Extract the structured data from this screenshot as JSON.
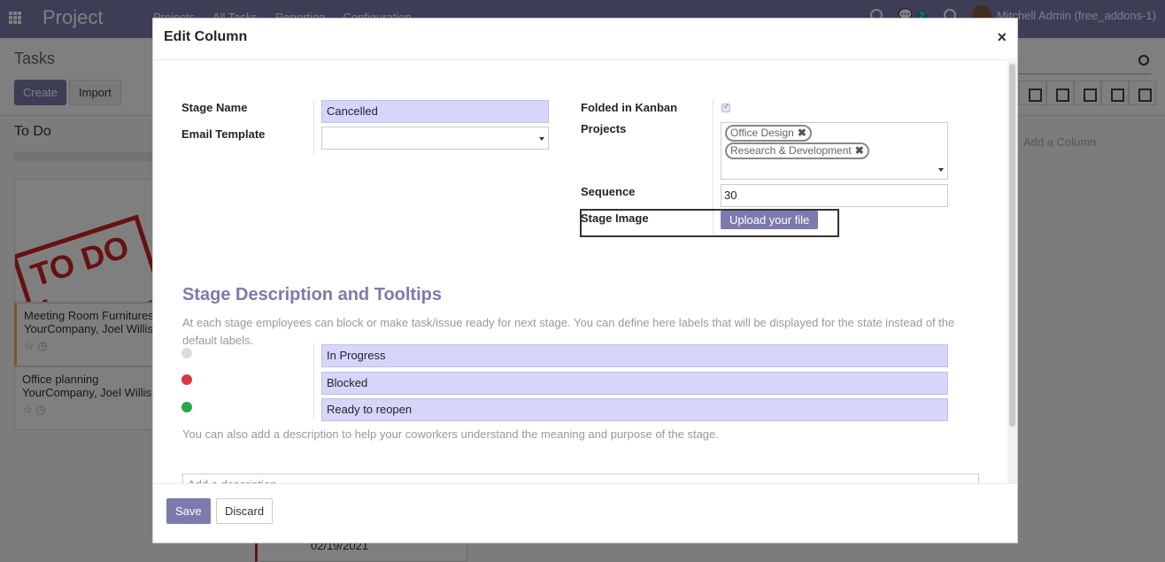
{
  "app": {
    "brand": "Project",
    "nav": [
      "Projects",
      "All Tasks",
      "Reporting",
      "Configuration"
    ],
    "messages_count": "2",
    "user": "Mitchell Admin (free_addons-1)"
  },
  "control_panel": {
    "title": "Tasks",
    "create_label": "Create",
    "import_label": "Import"
  },
  "kanban": {
    "column_title": "To Do",
    "stamp_text": "TO DO L",
    "cards": [
      {
        "title": "Meeting Room Furnitures",
        "subtitle": "YourCompany, Joel Willis"
      },
      {
        "title": "Office planning",
        "subtitle": "YourCompany, Joel Willis"
      }
    ],
    "add_column": "Add a Column",
    "bottom_card_date": "02/19/2021"
  },
  "dialog": {
    "title": "Edit Column",
    "close_glyph": "×",
    "fields": {
      "stage_name_label": "Stage Name",
      "stage_name_value": "Cancelled",
      "email_template_label": "Email Template",
      "email_template_value": "",
      "folded_label": "Folded in Kanban",
      "folded_checked": true,
      "projects_label": "Projects",
      "projects": [
        "Office Design",
        "Research & Development"
      ],
      "sequence_label": "Sequence",
      "sequence_value": "30",
      "stage_image_label": "Stage Image",
      "upload_label": "Upload your file"
    },
    "section": {
      "title": "Stage Description and Tooltips",
      "help_1": "At each stage employees can block or make task/issue ready for next stage. You can define here labels that will be displayed for the state instead of the default labels.",
      "states": [
        {
          "color": "#dddddd",
          "value": "In Progress"
        },
        {
          "color": "#dc3545",
          "value": "Blocked"
        },
        {
          "color": "#28a745",
          "value": "Ready to reopen"
        }
      ],
      "help_2": "You can also add a description to help your coworkers understand the meaning and purpose of the stage.",
      "description_placeholder": "Add a description..."
    },
    "footer": {
      "save_label": "Save",
      "discard_label": "Discard"
    }
  },
  "colors": {
    "brand": "#7c7bad",
    "field_bg": "#d6d6fa"
  }
}
